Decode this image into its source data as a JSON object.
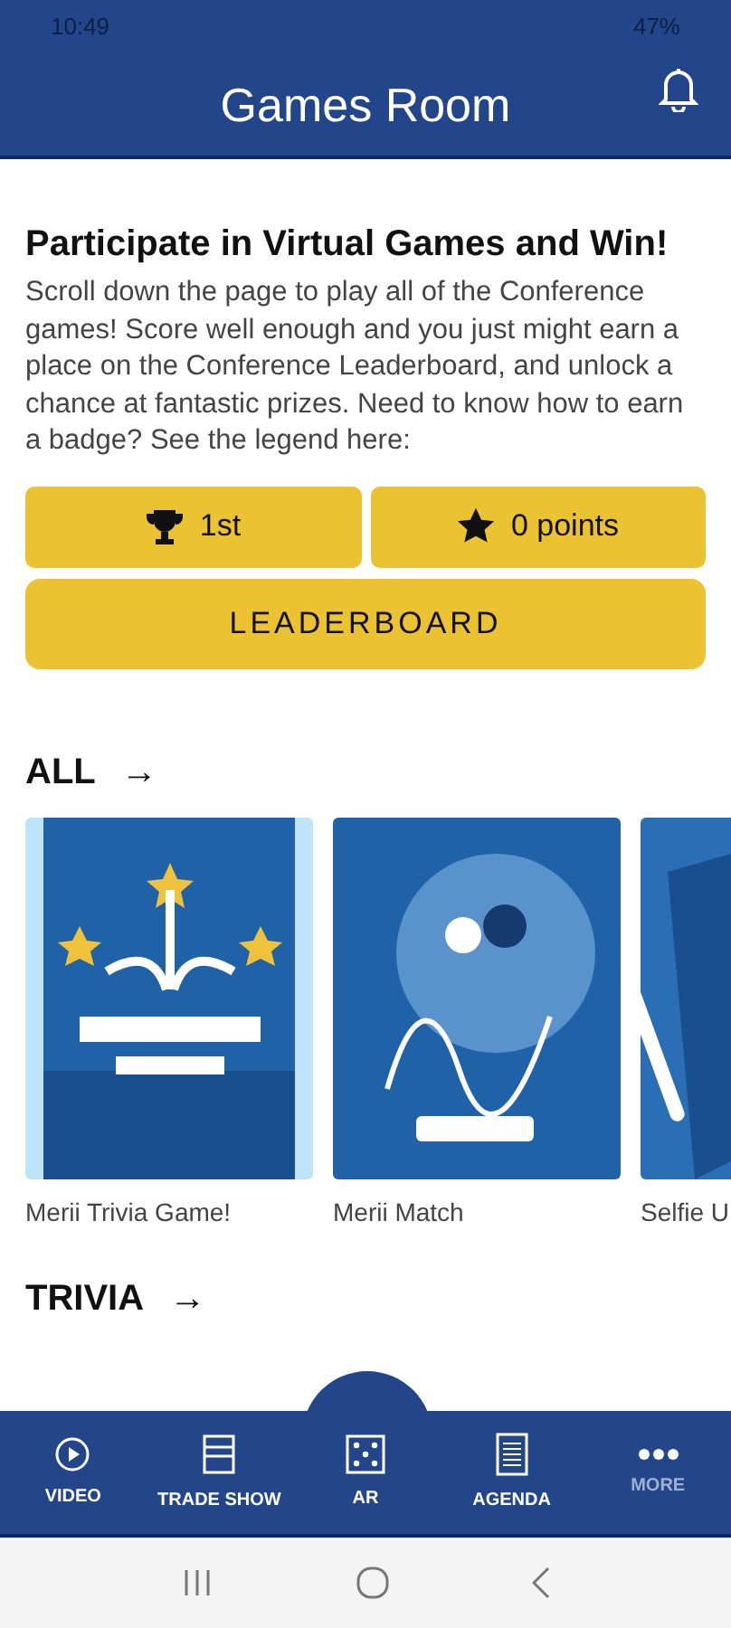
{
  "status_bar": {
    "time": "10:49",
    "battery": "47%"
  },
  "header": {
    "title": "Games Room"
  },
  "intro": {
    "heading": "Participate in Virtual Games and Win!",
    "body": "Scroll down the page to play all of the Conference games! Score well enough and you just might earn a place on the Conference Leaderboard, and unlock a chance at fantastic prizes. Need to know how to earn a badge? See the legend here:"
  },
  "stats": [
    {
      "kind": "rank",
      "label": "1st"
    },
    {
      "kind": "points",
      "label": "0 points"
    }
  ],
  "leaderboard_button": "LEADERBOARD",
  "sections": [
    {
      "title": "ALL",
      "arrow": "→",
      "games": [
        {
          "kind": "picture",
          "caption": "Merii Trivia Game!"
        },
        {
          "kind": "picture",
          "caption": "Merii Match"
        },
        {
          "kind": "picture",
          "caption": "Selfie U"
        }
      ]
    },
    {
      "title": "TRIVIA",
      "arrow": "→"
    }
  ],
  "nav": [
    {
      "kind": "play",
      "label": "VIDEO",
      "selected": false
    },
    {
      "kind": "booth",
      "label": "TRADE SHOW",
      "selected": false
    },
    {
      "kind": "dice",
      "label": "AR",
      "selected": false
    },
    {
      "kind": "list",
      "label": "AGENDA",
      "selected": false
    },
    {
      "kind": "dots",
      "label": "MORE",
      "selected": true
    }
  ]
}
